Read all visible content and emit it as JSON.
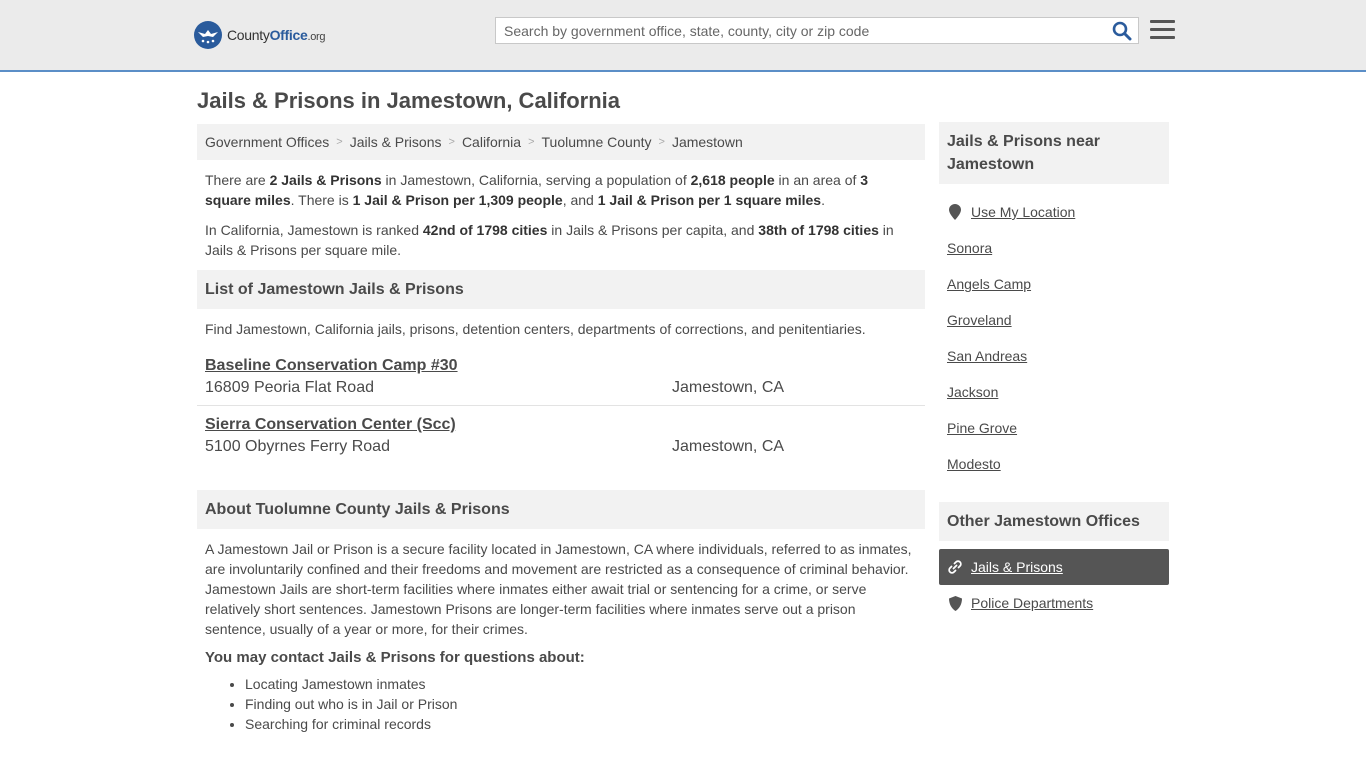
{
  "header": {
    "logo_main": "County",
    "logo_brand": "Office",
    "logo_tld": ".org",
    "search_placeholder": "Search by government office, state, county, city or zip code"
  },
  "page_title": "Jails & Prisons in Jamestown, California",
  "breadcrumbs": [
    "Government Offices",
    "Jails & Prisons",
    "California",
    "Tuolumne County",
    "Jamestown"
  ],
  "intro": {
    "p1": {
      "t1": "There are ",
      "b1": "2 Jails & Prisons",
      "t2": " in Jamestown, California, serving a population of ",
      "b2": "2,618 people",
      "t3": " in an area of ",
      "b3": "3 square miles",
      "t4": ". There is ",
      "b4": "1 Jail & Prison per 1,309 people",
      "t5": ", and ",
      "b5": "1 Jail & Prison per 1 square miles",
      "t6": "."
    },
    "p2": {
      "t1": "In California, Jamestown is ranked ",
      "b1": "42nd of 1798 cities",
      "t2": " in Jails & Prisons per capita, and ",
      "b2": "38th of 1798 cities",
      "t3": " in Jails & Prisons per square mile."
    }
  },
  "list_section": {
    "heading": "List of Jamestown Jails & Prisons",
    "description": "Find Jamestown, California jails, prisons, detention centers, departments of corrections, and penitentiaries.",
    "listings": [
      {
        "name": "Baseline Conservation Camp #30",
        "street": "16809 Peoria Flat Road",
        "city": "Jamestown, CA"
      },
      {
        "name": "Sierra Conservation Center (Scc)",
        "street": "5100 Obyrnes Ferry Road",
        "city": "Jamestown, CA"
      }
    ]
  },
  "about_section": {
    "heading": "About Tuolumne County Jails & Prisons",
    "body": "A Jamestown Jail or Prison is a secure facility located in Jamestown, CA where individuals, referred to as inmates, are involuntarily confined and their freedoms and movement are restricted as a consequence of criminal behavior. Jamestown Jails are short-term facilities where inmates either await trial or sentencing for a crime, or serve relatively short sentences. Jamestown Prisons are longer-term facilities where inmates serve out a prison sentence, usually of a year or more, for their crimes.",
    "contact_heading": "You may contact Jails & Prisons for questions about:",
    "contact_items": [
      "Locating Jamestown inmates",
      "Finding out who is in Jail or Prison",
      "Searching for criminal records"
    ]
  },
  "sidebar": {
    "nearby_heading": "Jails & Prisons near Jamestown",
    "use_location": "Use My Location",
    "nearby_cities": [
      "Sonora",
      "Angels Camp",
      "Groveland",
      "San Andreas",
      "Jackson",
      "Pine Grove",
      "Modesto"
    ],
    "other_heading": "Other Jamestown Offices",
    "active_office": "Jails & Prisons",
    "other_offices": [
      "Police Departments"
    ]
  },
  "colors": {
    "brand_blue": "#2a5b9c",
    "header_border": "#5b8ec7",
    "active_bg": "#555555"
  }
}
